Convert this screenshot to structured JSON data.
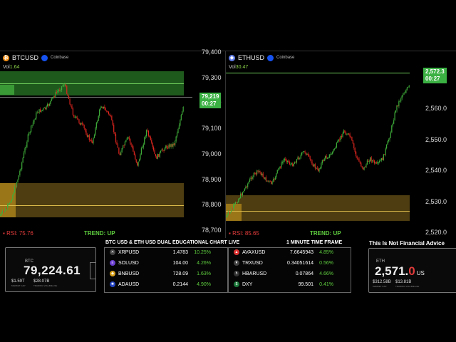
{
  "btc_chart": {
    "symbol": "BTCUSD",
    "exchange": "Coinbase",
    "vol_label": "Vol",
    "vol_value": "1.64",
    "price_tag": "79,219",
    "countdown": "00:27",
    "y_ticks": [
      "79,400",
      "79,300",
      "79,200",
      "79,100",
      "79,000",
      "78,900",
      "78,800",
      "78,700"
    ],
    "rsi": "RSI: 75.76",
    "trend": "TREND: UP"
  },
  "eth_chart": {
    "symbol": "ETHUSD",
    "exchange": "Coinbase",
    "vol_label": "Vol",
    "vol_value": "30.47",
    "price_tag": "2,572.3",
    "countdown": "00:27",
    "y_ticks": [
      "2,560.0",
      "2,550.0",
      "2,540.0",
      "2,530.0",
      "2,520.0"
    ],
    "rsi": "RSI: 85.65",
    "trend": "TREND: UP"
  },
  "btc_box": {
    "label": "BTC",
    "price": "79,224.61",
    "market_cap": "$1.59T",
    "volume": "$28.07B",
    "market_cap_label": "MARKET CAP",
    "volume_label": "TRADING VOLUME 24H"
  },
  "eth_box": {
    "label": "ETH",
    "price_main": "2,571.",
    "price_dec": "0",
    "currency": "US",
    "market_cap": "$312.58B",
    "volume": "$13.81B",
    "market_cap_label": "MARKET CAP",
    "volume_label": "TRADING VOLUME 24H"
  },
  "banner": {
    "title": "BTC USD & ETH USD DUAL EDUCATIONAL CHART LIVE",
    "timeframe": "1 MINUTE TIME FRAME",
    "disclaimer": "This Is Not Financial Advice"
  },
  "tickers_left": [
    {
      "icon": "xrp-icon",
      "glyph": "✕",
      "color": "#444",
      "symbol": "XRPUSD",
      "price": "1.4783",
      "change": "10.25%"
    },
    {
      "icon": "sol-icon",
      "glyph": "≡",
      "color": "#6b3fd1",
      "symbol": "SOLUSD",
      "price": "104.00",
      "change": "4.26%"
    },
    {
      "icon": "bnb-icon",
      "glyph": "◆",
      "color": "#d9a11a",
      "symbol": "BNBUSD",
      "price": "728.09",
      "change": "1.63%"
    },
    {
      "icon": "ada-icon",
      "glyph": "✺",
      "color": "#2545c4",
      "symbol": "ADAUSD",
      "price": "0.2144",
      "change": "4.90%"
    }
  ],
  "tickers_right": [
    {
      "icon": "avax-icon",
      "glyph": "▲",
      "color": "#d33",
      "symbol": "AVAXUSD",
      "price": "7.6645943",
      "change": "4.85%"
    },
    {
      "icon": "trx-icon",
      "glyph": "▼",
      "color": "#444",
      "symbol": "TRXUSD",
      "price": "0.34051614",
      "change": "0.56%"
    },
    {
      "icon": "hbar-icon",
      "glyph": "ħ",
      "color": "#333",
      "symbol": "HBARUSD",
      "price": "0.07864",
      "change": "4.66%"
    },
    {
      "icon": "dxy-icon",
      "glyph": "$",
      "color": "#1b7a3a",
      "symbol": "DXY",
      "price": "99.501",
      "change": "0.41%"
    }
  ]
}
